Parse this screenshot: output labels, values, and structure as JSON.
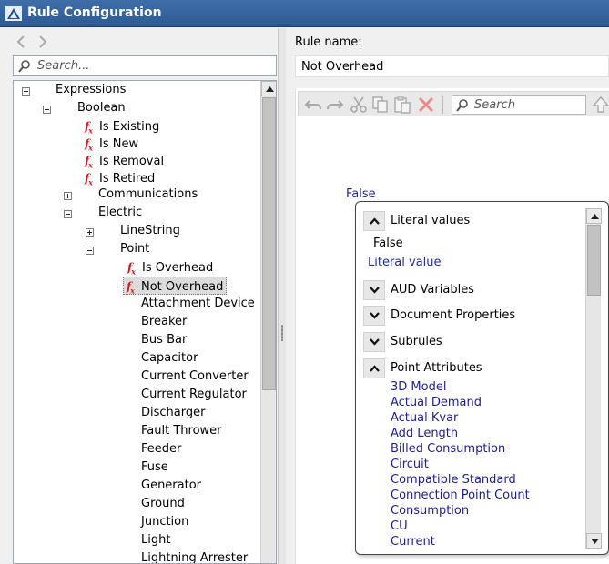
{
  "window": {
    "title": "Rule Configuration",
    "accent": "#3f6ea8"
  },
  "left": {
    "search_placeholder": "Search...",
    "tree": {
      "expressions": "Expressions",
      "boolean": "Boolean",
      "boolean_items": [
        "Is Existing",
        "Is New",
        "Is Removal",
        "Is Retired"
      ],
      "communications": "Communications",
      "electric": "Electric",
      "linestring": "LineString",
      "point": "Point",
      "point_fx_items": [
        "Is Overhead",
        "Not Overhead"
      ],
      "selected_item": "Not Overhead",
      "point_children": [
        "Attachment Device",
        "Breaker",
        "Bus Bar",
        "Capacitor",
        "Current Converter",
        "Current Regulator",
        "Discharger",
        "Fault Thrower",
        "Feeder",
        "Fuse",
        "Generator",
        "Ground",
        "Junction",
        "Light",
        "Lightning Arrester"
      ]
    }
  },
  "right": {
    "rule_name_label": "Rule name:",
    "rule_name_value": "Not Overhead",
    "toolbar": {
      "search_placeholder": "Search",
      "icons": [
        "undo-icon",
        "redo-icon",
        "cut-icon",
        "copy-icon",
        "paste-icon",
        "delete-icon",
        "search-icon",
        "move-up-icon"
      ]
    },
    "expression_value": "False",
    "popup": {
      "literal_header": "Literal values",
      "literal_false": "False",
      "literal_link": "Literal value",
      "aud_header": "AUD Variables",
      "doc_header": "Document Properties",
      "subrules_header": "Subrules",
      "point_attr_header": "Point Attributes",
      "point_attributes": [
        "3D Model",
        "Actual Demand",
        "Actual Kvar",
        "Add Length",
        "Billed Consumption",
        "Circuit",
        "Compatible Standard",
        "Connection Point Count",
        "Consumption",
        "CU",
        "Current"
      ]
    }
  }
}
